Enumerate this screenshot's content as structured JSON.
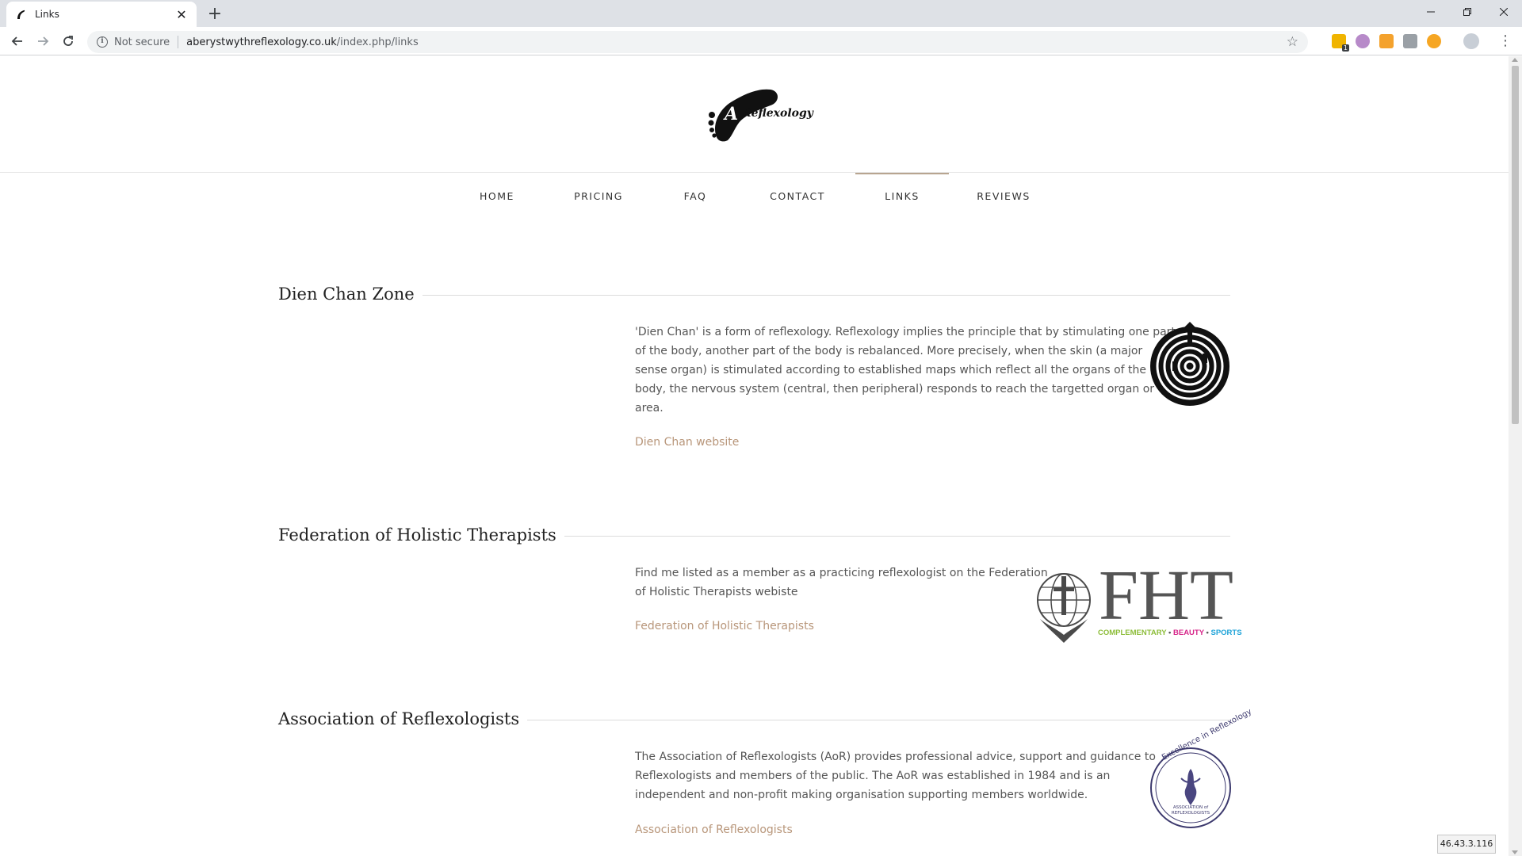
{
  "browser": {
    "tab_title": "Links",
    "new_tab_label": "+",
    "security_label": "Not secure",
    "url_host": "aberystwythreflexology.co.uk",
    "url_path": "/index.php/links"
  },
  "site": {
    "logo_text": "Reflexology",
    "nav": [
      {
        "label": "HOME"
      },
      {
        "label": "PRICING"
      },
      {
        "label": "FAQ"
      },
      {
        "label": "CONTACT"
      },
      {
        "label": "LINKS",
        "active": true
      },
      {
        "label": "REVIEWS"
      }
    ],
    "accent_color": "#b8967a"
  },
  "sections": [
    {
      "title": "Dien Chan Zone",
      "body_lines": [
        "'Dien Chan' is a form of reflexology. Reflexology implies the principle that by stimulating one part",
        "of the body, another part of the body is rebalanced. More precisely, when the skin (a major",
        "sense organ) is stimulated according to established maps which reflect all the organs of the",
        "body, the nervous system (central, then peripheral) responds to reach the targetted organ or",
        "area."
      ],
      "link": "Dien Chan website"
    },
    {
      "title": "Federation of Holistic Therapists",
      "body_lines": [
        "Find me listed as a member as a practicing reflexologist on the Federation",
        "of Holistic Therapists webiste"
      ],
      "link": "Federation of Holistic Therapists",
      "logo": {
        "wordmark": "FHT",
        "tagline_1": "COMPLEMENTARY",
        "tagline_2": "BEAUTY",
        "tagline_3": "SPORTS",
        "tagline_sep": "•"
      }
    },
    {
      "title": "Association of Reflexologists",
      "body_lines": [
        "The Association of Reflexologists (AoR) provides professional advice, support and guidance to",
        "Reflexologists and members of the public. The AoR was established in 1984 and is an",
        "independent and non-profit making organisation supporting members worldwide."
      ],
      "link": "Association of Reflexologists",
      "logo": {
        "ring_text": "Excellence in Reflexology",
        "inner_line_1": "ASSOCIATION of",
        "inner_line_2": "REFLEXOLOGISTS"
      }
    }
  ],
  "status": {
    "ip": "46.43.3.116"
  }
}
